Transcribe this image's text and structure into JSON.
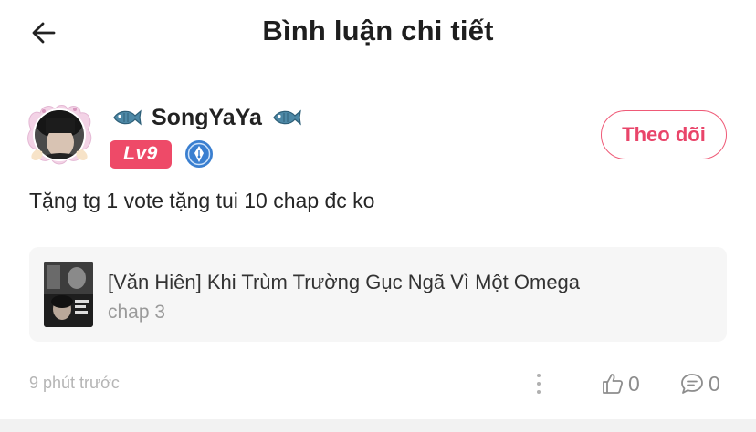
{
  "header": {
    "title": "Bình luận chi tiết",
    "back_icon": "arrow-left-icon"
  },
  "user": {
    "name": "SongYaYa",
    "level": "Lv9",
    "name_decoration_icon": "fish-icon",
    "rank_icon": "pen-medal-icon",
    "follow_label": "Theo dõi"
  },
  "comment": {
    "text": "Tặng tg 1 vote tặng tui 10 chap đc ko"
  },
  "story": {
    "title": "[Văn Hiên] Khi Trùm Trường Gục Ngã Vì Một Omega",
    "chapter": "chap 3"
  },
  "footer": {
    "time": "9 phút trước",
    "like_count": "0",
    "reply_count": "0",
    "more_icon": "vertical-dots-icon",
    "like_icon": "thumbs-up-icon",
    "reply_icon": "comment-bubble-icon"
  },
  "colors": {
    "accent": "#ee4a68",
    "muted": "#9a9a9a",
    "card_bg": "#f6f6f6"
  }
}
